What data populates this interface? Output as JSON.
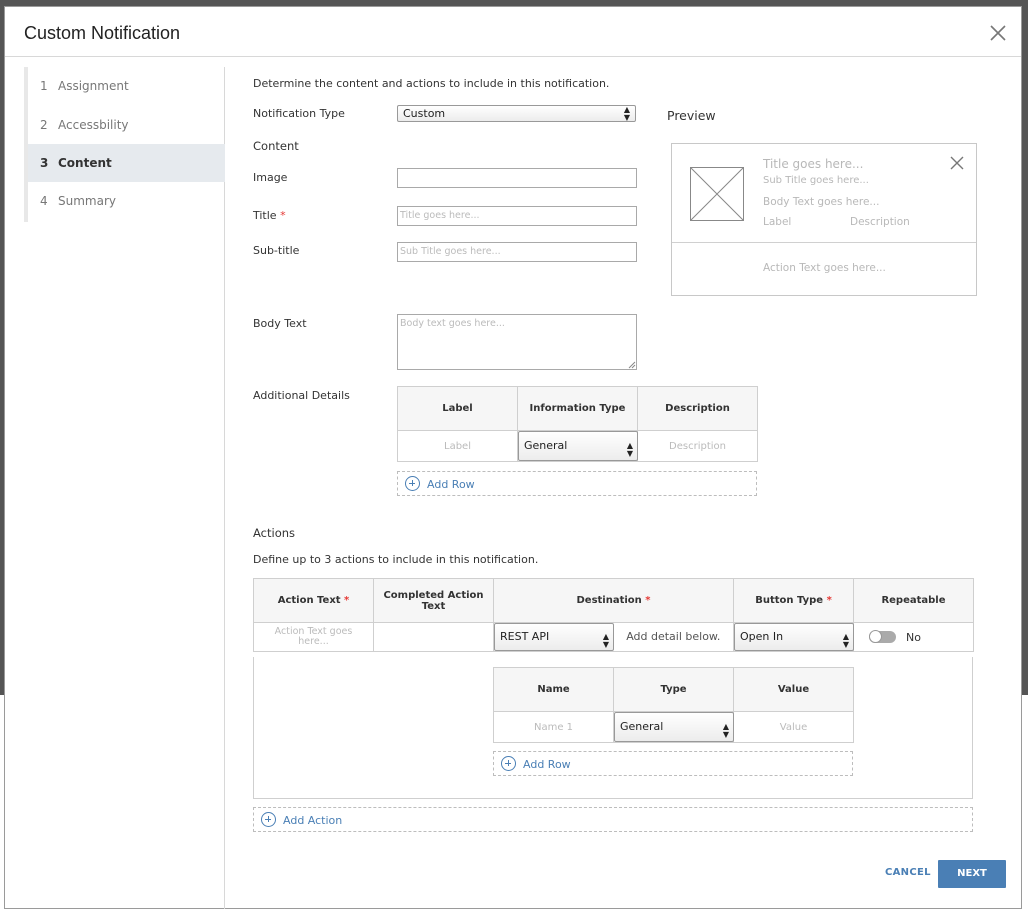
{
  "modal": {
    "title": "Custom Notification"
  },
  "steps": [
    {
      "num": "1",
      "label": "Assignment"
    },
    {
      "num": "2",
      "label": "Accessbility"
    },
    {
      "num": "3",
      "label": "Content"
    },
    {
      "num": "4",
      "label": "Summary"
    }
  ],
  "active_step": "3",
  "content": {
    "intro": "Determine the content and actions to include in this notification.",
    "notification_type_label": "Notification Type",
    "notification_type_value": "Custom",
    "section_content": "Content",
    "image_label": "Image",
    "title_label": "Title",
    "required_mark": "*",
    "title_placeholder": "Title goes here...",
    "subtitle_label": "Sub-title",
    "subtitle_placeholder": "Sub Title goes here...",
    "body_label": "Body Text",
    "body_placeholder": "Body text goes here...",
    "additional_label": "Additional Details",
    "details_table": {
      "headers": [
        "Label",
        "Information Type",
        "Description"
      ],
      "row": {
        "label_placeholder": "Label",
        "info_type": "General",
        "description_placeholder": "Description"
      }
    },
    "add_row": "Add Row"
  },
  "preview": {
    "heading": "Preview",
    "title": "Title goes here...",
    "subtitle": "Sub Title goes here...",
    "body": "Body Text goes here...",
    "label": "Label",
    "description": "Description",
    "action_text": "Action Text goes here..."
  },
  "actions": {
    "heading": "Actions",
    "intro": "Define up to 3 actions to include in this notification.",
    "headers": {
      "action_text": "Action Text",
      "completed": "Completed Action Text",
      "destination": "Destination",
      "button_type": "Button Type",
      "repeatable": "Repeatable"
    },
    "row": {
      "action_placeholder": "Action Text goes here...",
      "destination": "REST API",
      "detail_hint": "Add detail below.",
      "button_type": "Open In",
      "repeatable_value": "No"
    },
    "params_table": {
      "headers": [
        "Name",
        "Type",
        "Value"
      ],
      "row": {
        "name_placeholder": "Name 1",
        "type": "General",
        "value_placeholder": "Value"
      }
    },
    "add_row": "Add Row",
    "add_action": "Add Action"
  },
  "footer": {
    "cancel": "CANCEL",
    "next": "NEXT"
  },
  "colors": {
    "accent": "#4a7fb5",
    "required": "#e53935",
    "active_step_bg": "#e6eaee"
  }
}
